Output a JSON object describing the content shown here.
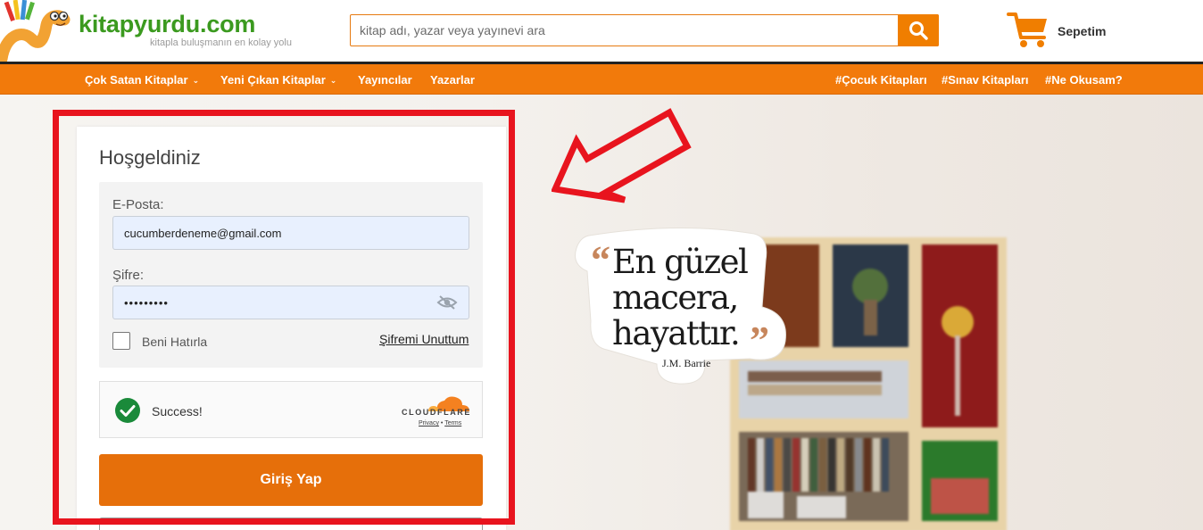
{
  "header": {
    "logo_text": "kitapyurdu.com",
    "slogan": "kitapla buluşmanın en kolay yolu",
    "search": {
      "placeholder": "kitap adı, yazar veya yayınevi ara",
      "value": ""
    },
    "cart_label": "Sepetim",
    "colors": {
      "brand_green": "#3b9a1f",
      "accent_orange": "#f27a0b"
    }
  },
  "nav": {
    "items": [
      {
        "label": "Çok Satan Kitaplar",
        "has_dropdown": true
      },
      {
        "label": "Yeni Çıkan Kitaplar",
        "has_dropdown": true
      },
      {
        "label": "Yayıncılar",
        "has_dropdown": false
      },
      {
        "label": "Yazarlar",
        "has_dropdown": false
      }
    ],
    "tags": [
      {
        "label": "#Çocuk Kitapları"
      },
      {
        "label": "#Sınav Kitapları"
      },
      {
        "label": "#Ne Okusam?"
      }
    ]
  },
  "login": {
    "title": "Hoşgeldiniz",
    "email_label": "E-Posta:",
    "email_value": "cucumberdeneme@gmail.com",
    "password_label": "Şifre:",
    "password_value": "•••••••••",
    "remember_label": "Beni Hatırla",
    "remember_checked": false,
    "forgot_label": "Şifremi Unuttum",
    "captcha": {
      "status": "Success!",
      "provider": "CLOUDFLARE",
      "privacy": "Privacy",
      "separator": "•",
      "terms": "Terms"
    },
    "submit_label": "Giriş Yap"
  },
  "quote": {
    "open_mark": "“",
    "line1": "En güzel",
    "line2": "macera,",
    "line3": "hayattır.",
    "close_mark": "”",
    "author": "J.M. Barrie"
  },
  "icons": {
    "search": "search-icon",
    "cart": "cart-icon",
    "eye": "eye-slash-icon",
    "check": "check-circle-icon",
    "cloudflare": "cloudflare-logo-icon"
  }
}
